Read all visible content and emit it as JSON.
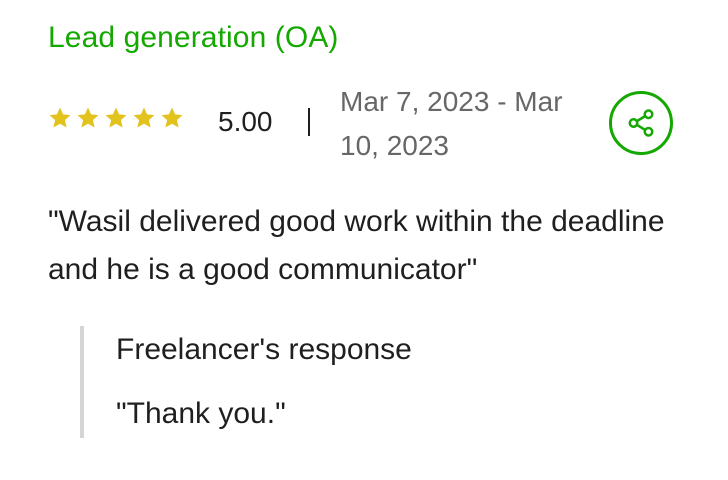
{
  "review": {
    "job_title": "Lead generation (OA)",
    "rating": {
      "stars_filled": 5,
      "stars_total": 5,
      "score": "5.00",
      "star_color": "#e2c31d"
    },
    "date_range": "Mar 7, 2023 - Mar 10, 2023",
    "share_icon": "share-icon",
    "feedback": "\"Wasil delivered good work within the deadline and he is a good communicator\"",
    "freelancer_response": {
      "title": "Freelancer's response",
      "text": "\"Thank you.\""
    }
  },
  "colors": {
    "brand_green": "#14a800",
    "text_primary": "#1f1f1f",
    "text_muted": "#676767",
    "response_border": "#d5d5d5"
  }
}
